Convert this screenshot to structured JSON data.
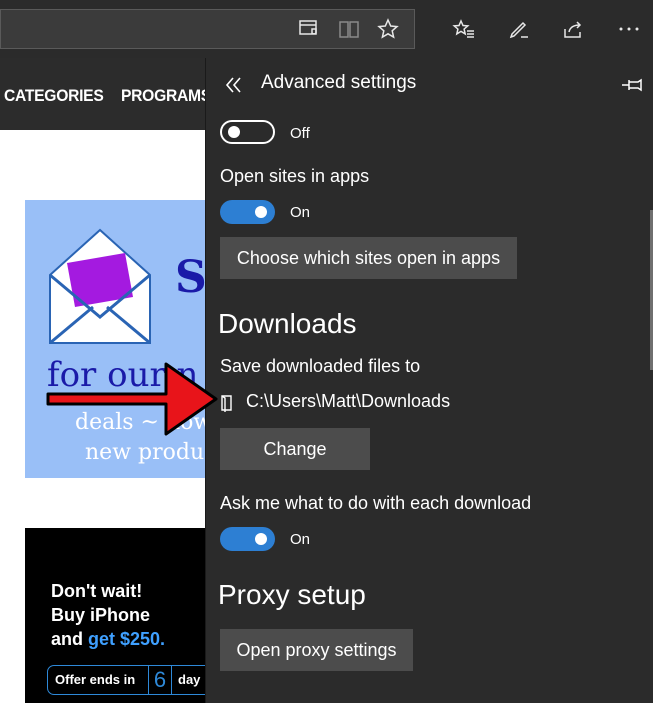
{
  "browser": {
    "toolbar_icons": [
      "reading-list-add-icon",
      "reading-view-icon",
      "favorite-star-icon",
      "favorites-hub-icon",
      "web-note-icon",
      "share-icon",
      "more-icon"
    ]
  },
  "website": {
    "nav": [
      "CATEGORIES",
      "PROGRAMS"
    ],
    "ad1": {
      "partial_title": "S",
      "line1": "for our n",
      "line2": "deals ~ how",
      "line3": "new produ"
    },
    "ad2": {
      "line1": "Don't wait!",
      "line2": "Buy iPhone",
      "line3_prefix": "and ",
      "line3_highlight": "get $250.",
      "offer_label": "Offer ends in",
      "offer_number": "6",
      "offer_suffix": "day"
    }
  },
  "panel": {
    "title": "Advanced settings",
    "back_icon": "double-chevron-left-icon",
    "pin_icon": "pin-icon",
    "top_toggle_label": "Off",
    "open_sites_label": "Open sites in apps",
    "open_sites_toggle_label": "On",
    "choose_sites_button": "Choose which sites open in apps",
    "downloads_heading": "Downloads",
    "save_to_label": "Save downloaded files to",
    "download_path": "C:\\Users\\Matt\\Downloads",
    "change_button": "Change",
    "ask_label": "Ask me what to do with each download",
    "ask_toggle_label": "On",
    "proxy_heading": "Proxy setup",
    "proxy_button": "Open proxy settings"
  },
  "colors": {
    "panel_bg": "#2b2b2b",
    "toggle_on": "#2d7fd3",
    "button_bg": "#4c4c4c",
    "arrow": "#e8141a"
  }
}
